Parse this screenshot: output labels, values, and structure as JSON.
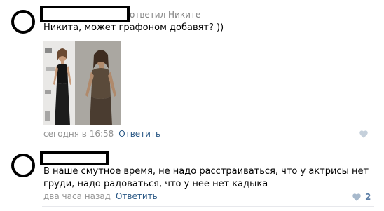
{
  "comments": [
    {
      "reply_to": "ответил Никите",
      "text": "Никита, может графоном добавят? ))",
      "date": "сегодня в 16:58",
      "reply_label": "Ответить",
      "likes": ""
    },
    {
      "text": "В наше смутное время, не надо расстраиваться, что у актрисы нет груди, надо радоваться, что у нее нет кадыка",
      "date": "два часа назад",
      "reply_label": "Ответить",
      "likes": "2"
    }
  ],
  "colors": {
    "link": "#2a5885",
    "meta": "#939393",
    "like": "#5b7ea6",
    "divider": "#e7e8ec"
  }
}
